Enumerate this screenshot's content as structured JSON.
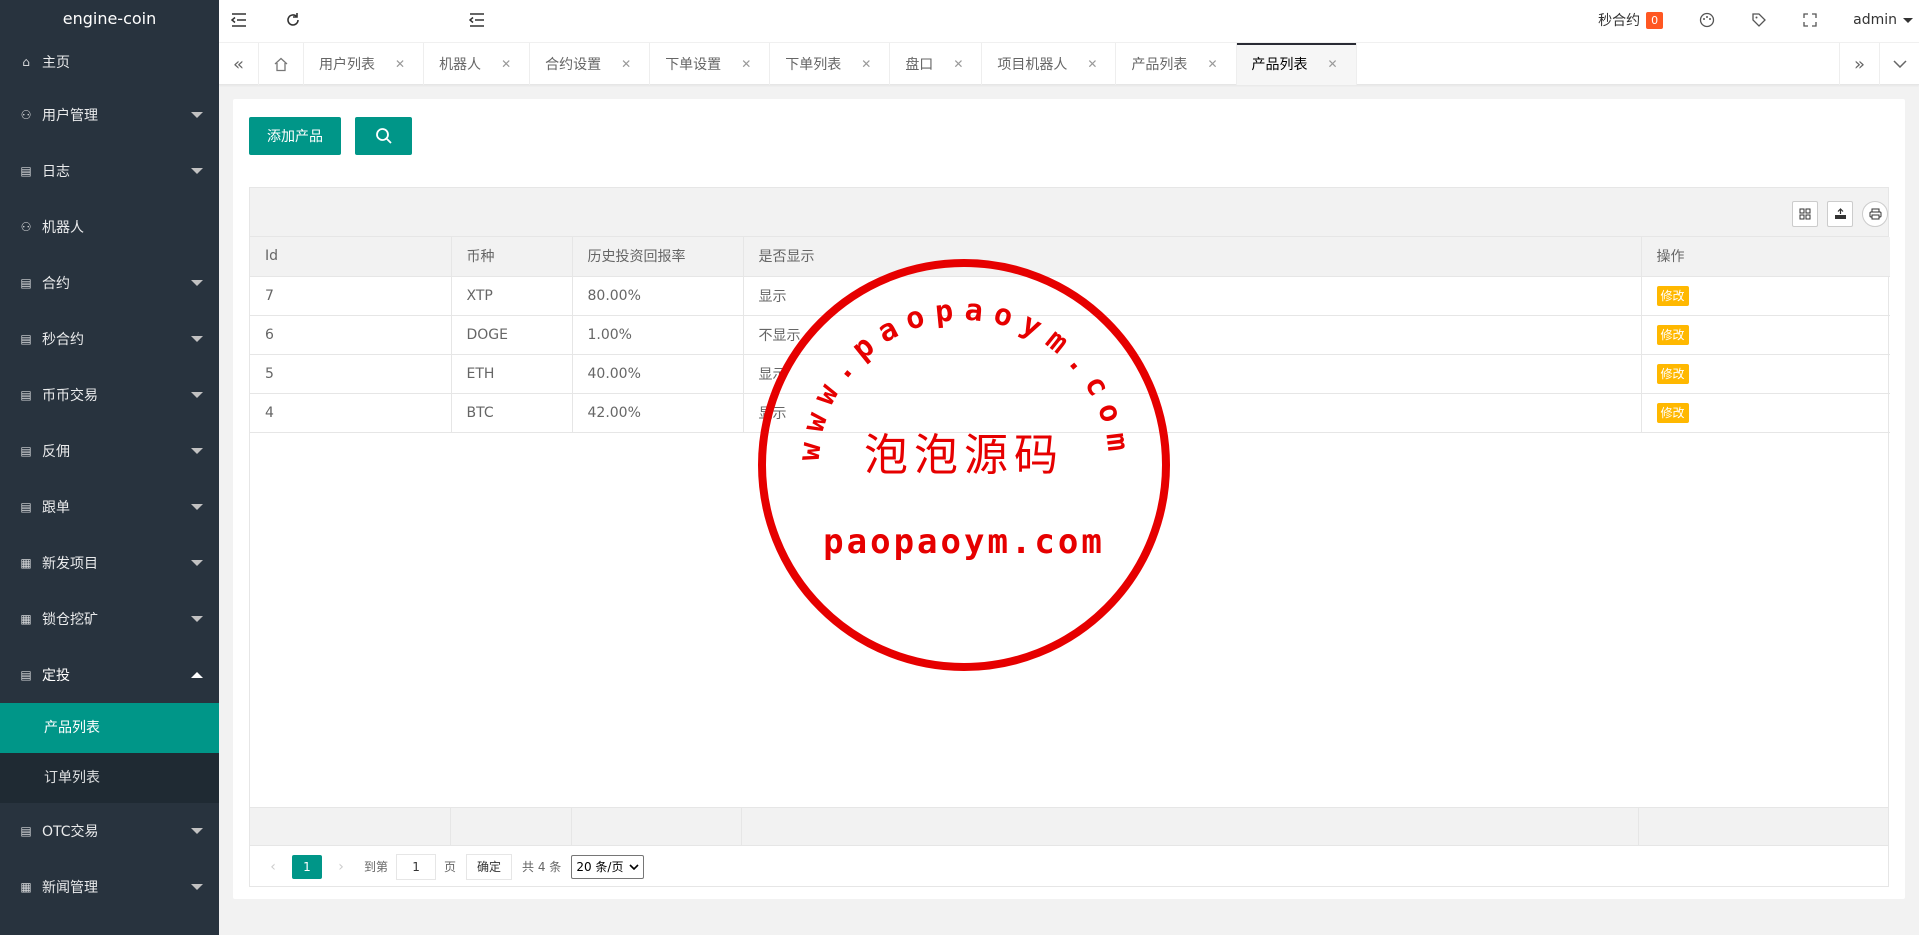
{
  "app": {
    "logo": "engine-coin"
  },
  "sidebar": {
    "items": [
      {
        "label": "主页",
        "icon": "home-icon"
      },
      {
        "label": "用户管理",
        "icon": "user-icon"
      },
      {
        "label": "日志",
        "icon": "doc-icon"
      },
      {
        "label": "机器人",
        "icon": "user-icon"
      },
      {
        "label": "合约",
        "icon": "doc-icon"
      },
      {
        "label": "秒合约",
        "icon": "doc-icon"
      },
      {
        "label": "币币交易",
        "icon": "doc-icon"
      },
      {
        "label": "反佣",
        "icon": "doc-icon"
      },
      {
        "label": "跟单",
        "icon": "doc-icon"
      },
      {
        "label": "新发项目",
        "icon": "news-icon"
      },
      {
        "label": "锁仓挖矿",
        "icon": "news-icon"
      },
      {
        "label": "定投",
        "icon": "doc-icon"
      },
      {
        "label": "OTC交易",
        "icon": "doc-icon"
      },
      {
        "label": "新闻管理",
        "icon": "news-icon"
      }
    ],
    "sub_items": [
      {
        "label": "产品列表"
      },
      {
        "label": "订单列表"
      }
    ]
  },
  "header": {
    "second_contract": "秒合约",
    "badge_count": "0",
    "user": "admin"
  },
  "tabs": [
    {
      "label": "用户列表"
    },
    {
      "label": "机器人"
    },
    {
      "label": "合约设置"
    },
    {
      "label": "下单设置"
    },
    {
      "label": "下单列表"
    },
    {
      "label": "盘口"
    },
    {
      "label": "项目机器人"
    },
    {
      "label": "产品列表"
    },
    {
      "label": "产品列表"
    }
  ],
  "toolbar": {
    "add_label": "添加产品"
  },
  "table": {
    "headers": [
      "Id",
      "币种",
      "历史投资回报率",
      "是否显示",
      "操作"
    ],
    "rows": [
      {
        "id": "7",
        "coin": "XTP",
        "rate": "80.00%",
        "show": "显示",
        "op": "修改"
      },
      {
        "id": "6",
        "coin": "DOGE",
        "rate": "1.00%",
        "show": "不显示",
        "op": "修改"
      },
      {
        "id": "5",
        "coin": "ETH",
        "rate": "40.00%",
        "show": "显示",
        "op": "修改"
      },
      {
        "id": "4",
        "coin": "BTC",
        "rate": "42.00%",
        "show": "显示",
        "op": "修改"
      }
    ]
  },
  "pager": {
    "current": "1",
    "goto": "到第",
    "page_input": "1",
    "page_unit": "页",
    "confirm": "确定",
    "total": "共 4 条",
    "per_page": "20 条/页"
  },
  "stamp": {
    "arc_text": "www.paopaoym.com",
    "center_text": "泡泡源码",
    "bottom_text": "paopaoym.com"
  },
  "colors": {
    "accent": "#009688",
    "sidebar": "#28333e",
    "warn": "#ffb800",
    "badge": "#ff5722",
    "stamp": "#e60000"
  }
}
